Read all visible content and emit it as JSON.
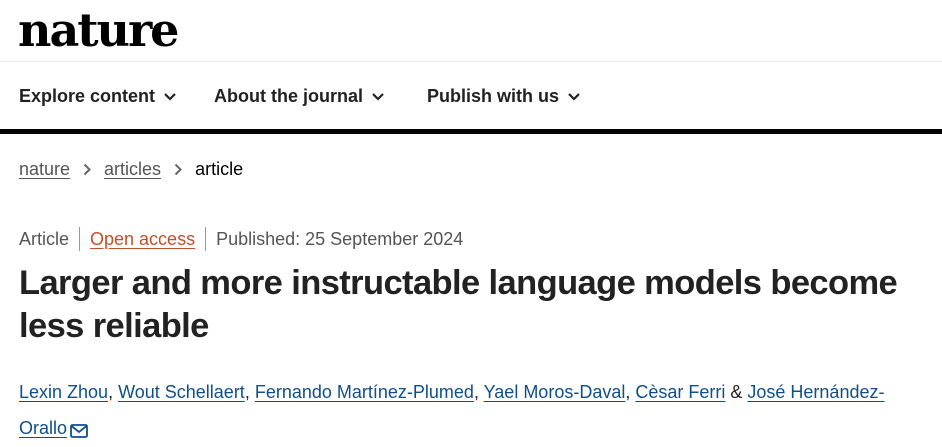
{
  "site": {
    "logo_text": "nature"
  },
  "nav": {
    "items": [
      {
        "label": "Explore content"
      },
      {
        "label": "About the journal"
      },
      {
        "label": "Publish with us"
      }
    ]
  },
  "breadcrumb": {
    "items": [
      "nature",
      "articles",
      "article"
    ]
  },
  "article": {
    "type": "Article",
    "access": "Open access",
    "published": "Published: 25 September 2024",
    "title": "Larger and more instructable language models become less reliable",
    "authors": [
      "Lexin Zhou",
      "Wout Schellaert",
      "Fernando Martínez-Plumed",
      "Yael Moros-Daval",
      "Cèsar Ferri",
      "José Hernández-Orallo"
    ],
    "author_separators": [
      ", ",
      ", ",
      ", ",
      ", ",
      " & "
    ]
  },
  "colors": {
    "link": "#0f4f8a",
    "open_access": "#c0502a",
    "text": "#222222",
    "muted": "#555555"
  },
  "icons": [
    "chevron-down-icon",
    "chevron-right-icon",
    "envelope-icon"
  ]
}
